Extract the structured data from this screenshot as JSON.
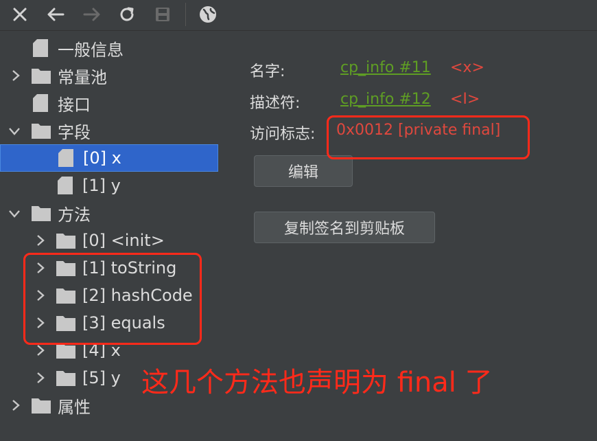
{
  "toolbar": {
    "buttons": [
      {
        "name": "close-icon"
      },
      {
        "name": "back-arrow-icon"
      },
      {
        "name": "forward-arrow-icon"
      },
      {
        "name": "refresh-icon"
      },
      {
        "name": "save-icon"
      },
      {
        "name": "globe-icon"
      }
    ]
  },
  "tree": {
    "general": "一般信息",
    "constant_pool": "常量池",
    "interfaces": "接口",
    "fields": "字段",
    "field_0": "[0] x",
    "field_1": "[1] y",
    "methods": "方法",
    "method_0": "[0] <init>",
    "method_1": "[1] toString",
    "method_2": "[2] hashCode",
    "method_3": "[3] equals",
    "method_4": "[4] x",
    "method_5": "[5] y",
    "attributes": "属性"
  },
  "detail": {
    "name_label": "名字:",
    "name_link": "cp_info #11",
    "name_tag": "<x>",
    "descriptor_label": "描述符:",
    "descriptor_link": "cp_info #12",
    "descriptor_tag": "<I>",
    "access_label": "访问标志:",
    "access_value": "0x0012 [private final]",
    "edit_button": "编辑",
    "copy_button": "复制签名到剪贴板"
  },
  "annotation": {
    "text": "这几个方法也声明为 final 了"
  },
  "colors": {
    "background": "#3c3f41",
    "selected": "#2f65ca",
    "link": "#5f9e24",
    "highlight": "#ff2a1a"
  }
}
